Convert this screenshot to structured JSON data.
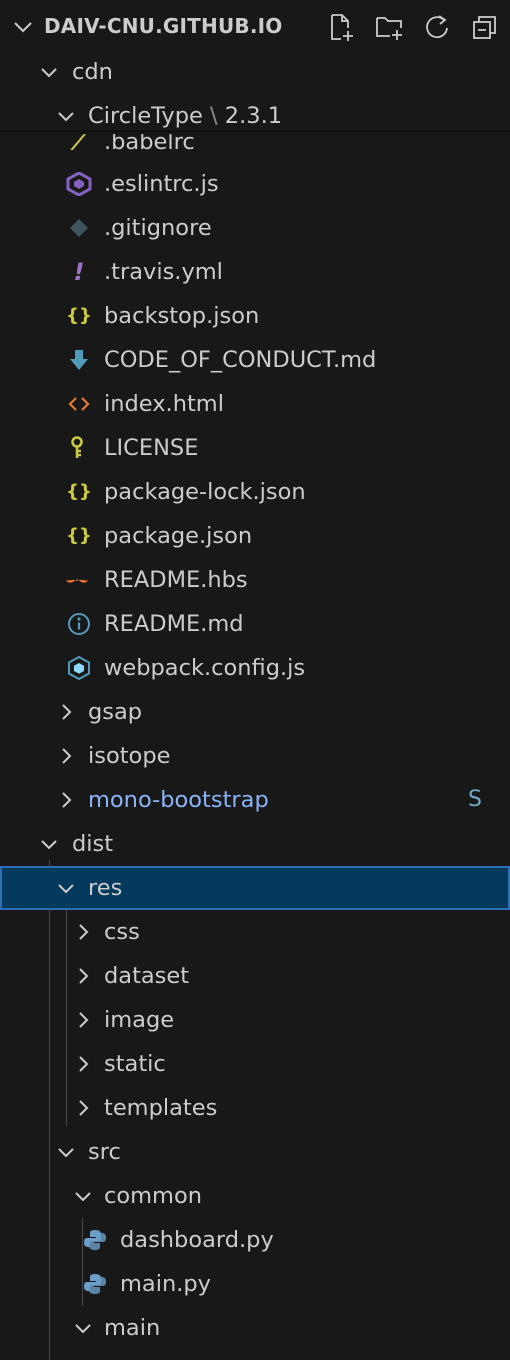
{
  "explorer": {
    "title": "DAIV-CNU.GITHUB.IO",
    "actions": [
      "new-file",
      "new-folder",
      "refresh",
      "collapse-all"
    ]
  },
  "tree": {
    "cdn": "cdn",
    "circletype_name": "CircleType",
    "circletype_sep": "\\",
    "circletype_version": "2.3.1",
    "files": {
      "babelrc": ".babelrc",
      "eslintrc": ".eslintrc.js",
      "gitignore": ".gitignore",
      "travis": ".travis.yml",
      "backstop": "backstop.json",
      "code_of_conduct": "CODE_OF_CONDUCT.md",
      "index_html": "index.html",
      "license": "LICENSE",
      "package_lock": "package-lock.json",
      "package_json": "package.json",
      "readme_hbs": "README.hbs",
      "readme_md": "README.md",
      "webpack": "webpack.config.js"
    },
    "gsap": "gsap",
    "isotope": "isotope",
    "mono_bootstrap": "mono-bootstrap",
    "mono_bootstrap_status": "S",
    "dist": "dist",
    "res": "res",
    "css": "css",
    "dataset": "dataset",
    "image": "image",
    "static": "static",
    "templates": "templates",
    "src": "src",
    "common": "common",
    "dashboard_py": "dashboard.py",
    "main_py": "main.py",
    "main": "main"
  },
  "colors": {
    "background": "#181818",
    "text": "#cccccc",
    "selection": "#04395e",
    "selection_border": "#2f6fb8",
    "git_status": "#73a8c8",
    "json_icon": "#cbcb41",
    "html_icon": "#e37933",
    "eslint_icon": "#8562bf",
    "python_icon": "#6b9fca"
  }
}
